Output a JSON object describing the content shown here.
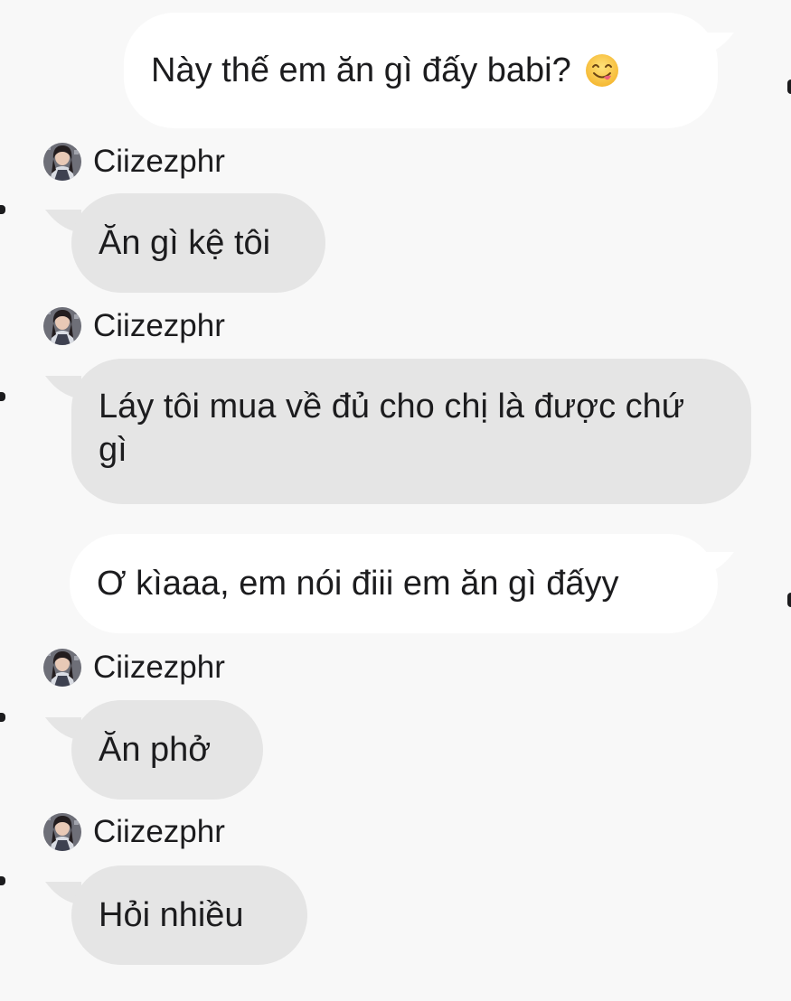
{
  "messages": [
    {
      "direction": "outgoing",
      "text": "Này thế em ăn gì đấy babi?",
      "emoji": "face-savoring-food-emoji"
    },
    {
      "direction": "incoming",
      "sender": "Ciizezphr",
      "text": "Ăn gì kệ tôi"
    },
    {
      "direction": "incoming",
      "sender": "Ciizezphr",
      "text": "Láy tôi mua về đủ cho chị là được chứ gì"
    },
    {
      "direction": "outgoing",
      "text": "Ơ kìaaa, em nói điii em ăn gì đấyy"
    },
    {
      "direction": "incoming",
      "sender": "Ciizezphr",
      "text": "Ăn phở"
    },
    {
      "direction": "incoming",
      "sender": "Ciizezphr",
      "text": "Hỏi nhiều"
    }
  ],
  "colors": {
    "background": "#f8f8f8",
    "outgoing_bubble": "#ffffff",
    "incoming_bubble": "#e5e5e5",
    "text": "#1c1c1e"
  }
}
